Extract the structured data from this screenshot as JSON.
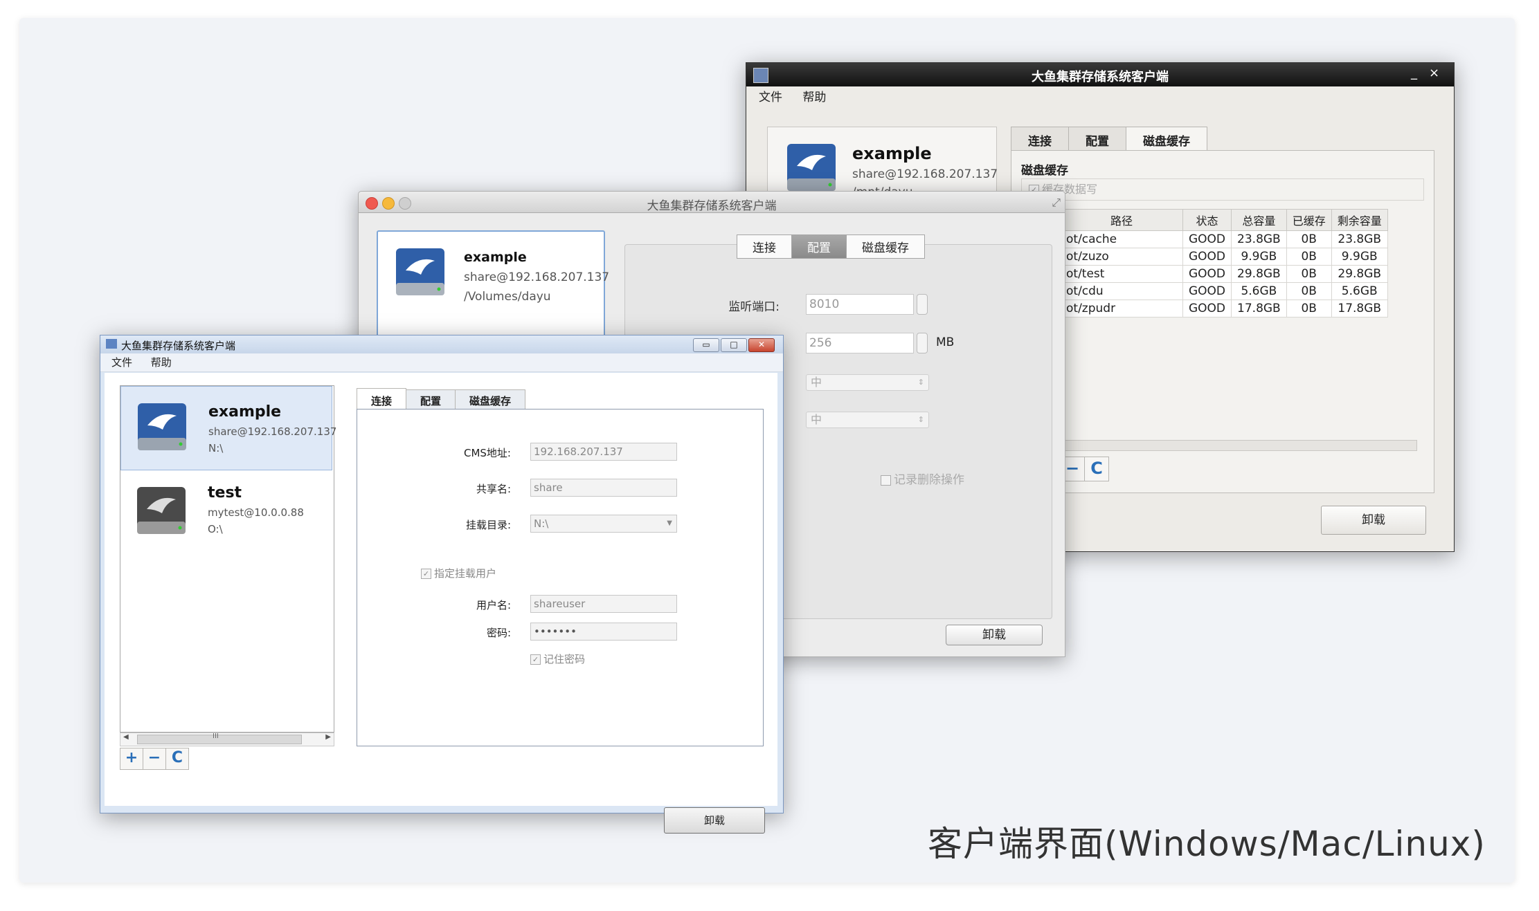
{
  "caption": "客户端界面(Windows/Mac/Linux)",
  "linux": {
    "title": "大鱼集群存储系统客户端",
    "minimize": "_",
    "close": "×",
    "menu": [
      "文件",
      "帮助"
    ],
    "drive": {
      "name": "example",
      "account": "share@192.168.207.137",
      "mount": "/mnt/dayu"
    },
    "tabs": [
      "连接",
      "配置",
      "磁盘缓存"
    ],
    "cache_heading": "磁盘缓存",
    "cache_write_label": "缓存数据写",
    "table": {
      "headers": [
        "路径",
        "状态",
        "总容量",
        "已缓存",
        "剩余容量"
      ],
      "rows": [
        [
          "ot/cache",
          "GOOD",
          "23.8GB",
          "0B",
          "23.8GB"
        ],
        [
          "ot/zuzo",
          "GOOD",
          "9.9GB",
          "0B",
          "9.9GB"
        ],
        [
          "ot/test",
          "GOOD",
          "29.8GB",
          "0B",
          "29.8GB"
        ],
        [
          "ot/cdu",
          "GOOD",
          "5.6GB",
          "0B",
          "5.6GB"
        ],
        [
          "ot/zpudr",
          "GOOD",
          "17.8GB",
          "0B",
          "17.8GB"
        ]
      ]
    },
    "remove_btn": "−",
    "refresh_btn": "C",
    "unmount": "卸载"
  },
  "mac": {
    "title": "大鱼集群存储系统客户端",
    "drive": {
      "name": "example",
      "account": "share@192.168.207.137",
      "mount": "/Volumes/dayu"
    },
    "tabs": [
      "连接",
      "配置",
      "磁盘缓存"
    ],
    "port_label": "监听端口:",
    "port_value": "8010",
    "cache_value": "256",
    "cache_unit": "MB",
    "select1": "中",
    "select2": "中",
    "log_delete_label": "记录删除操作",
    "unmount": "卸载"
  },
  "windows": {
    "title": "大鱼集群存储系统客户端",
    "menu": [
      "文件",
      "帮助"
    ],
    "drives": [
      {
        "name": "example",
        "account": "share@192.168.207.137",
        "mount": "N:\\"
      },
      {
        "name": "test",
        "account": "mytest@10.0.0.88",
        "mount": "O:\\"
      }
    ],
    "tabs": [
      "连接",
      "配置",
      "磁盘缓存"
    ],
    "scroll_grip": "III",
    "add_btn": "+",
    "remove_btn": "−",
    "refresh_btn": "C",
    "form": {
      "cms_label": "CMS地址:",
      "cms_value": "192.168.207.137",
      "share_label": "共享名:",
      "share_value": "share",
      "mountdir_label": "挂载目录:",
      "mountdir_value": "N:\\",
      "specify_user_label": "指定挂载用户",
      "username_label": "用户名:",
      "username_value": "shareuser",
      "password_label": "密码:",
      "password_value": "•••••••",
      "remember_label": "记住密码"
    },
    "unmount": "卸载"
  }
}
